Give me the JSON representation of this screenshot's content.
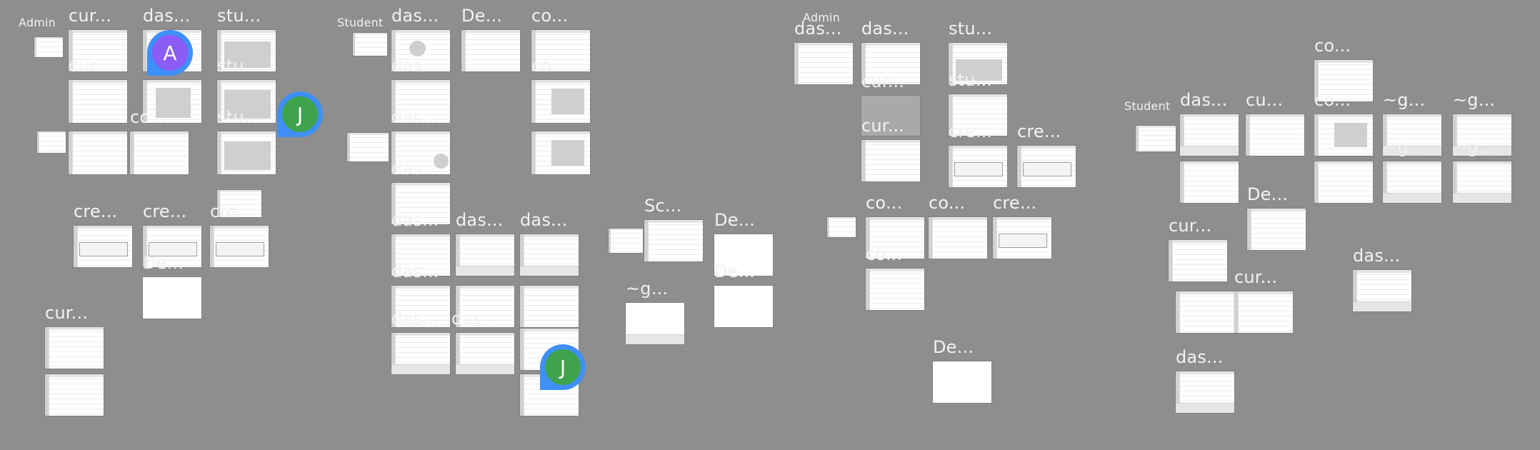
{
  "canvas": {
    "background": "#8e8e8e",
    "avatar_ring_color": "#3f8ff7"
  },
  "sections": {
    "admin_1": "Admin",
    "student_1": "Student",
    "admin_2": "Admin",
    "student_2": "Student"
  },
  "frame_labels": {
    "f01": "cur...",
    "f02": "das...",
    "f03": "stu...",
    "f04": "cur...",
    "f05": "stu...",
    "f06": "co...",
    "f07": "stu...",
    "f08": "cre...",
    "f09": "cre...",
    "f10": "cre...",
    "f11": "De...",
    "f12": "cur...",
    "f13": "das...",
    "f14": "De...",
    "f15": "co...",
    "f16": "das...",
    "f17": "co...",
    "f18": "das...",
    "f19": "das...",
    "f20": "das...",
    "f21": "das...",
    "f22": "das...",
    "f23": "das...",
    "f24": "das...",
    "f25": "das...",
    "f26": "Sc...",
    "f27": "De...",
    "f28": "De...",
    "f29": "~g...",
    "f30": "das...",
    "f31": "das...",
    "f32": "stu...",
    "f33": "cur...",
    "f34": "stu...",
    "f35": "cur...",
    "f36": "cre...",
    "f37": "cre...",
    "f38": "co...",
    "f39": "co...",
    "f40": "cre...",
    "f41": "co...",
    "f42": "De...",
    "f43": "co...",
    "f44": "das...",
    "f45": "cu...",
    "f46": "co...",
    "f47": "~g...",
    "f48": "~g...",
    "f49": "~g...",
    "f50": "~g...",
    "f51": "De...",
    "f52": "cur...",
    "f53": "cur...",
    "f54": "das...",
    "f55": "das..."
  },
  "collaborators": [
    {
      "initial": "A",
      "color": "#8b5cf6"
    },
    {
      "initial": "J",
      "color": "#3fa34d"
    },
    {
      "initial": "J",
      "color": "#3fa34d"
    }
  ]
}
